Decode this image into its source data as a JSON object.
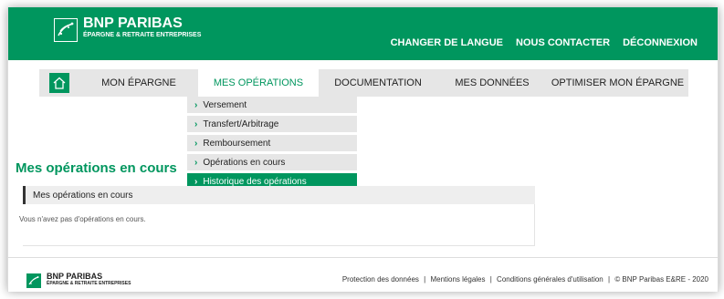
{
  "brand": {
    "name": "BNP PARIBAS",
    "sub": "ÉPARGNE & RETRAITE ENTREPRISES",
    "color": "#00965e"
  },
  "header_links": [
    "CHANGER DE LANGUE",
    "NOUS CONTACTER",
    "DÉCONNEXION"
  ],
  "nav": {
    "home_icon": "home-icon",
    "items": [
      {
        "label": "MON ÉPARGNE",
        "active": false
      },
      {
        "label": "MES OPÉRATIONS",
        "active": true
      },
      {
        "label": "DOCUMENTATION",
        "active": false
      },
      {
        "label": "MES DONNÉES",
        "active": false
      },
      {
        "label": "OPTIMISER MON ÉPARGNE",
        "active": false
      }
    ]
  },
  "dropdown": {
    "chevron": "›",
    "items": [
      "Versement",
      "Transfert/Arbitrage",
      "Remboursement",
      "Opérations en cours",
      "Historique des opérations"
    ]
  },
  "page": {
    "title": "Mes opérations en cours",
    "panel_title": "Mes opérations en cours",
    "empty_text": "Vous n'avez pas d'opérations en cours."
  },
  "footer": {
    "brand": "BNP PARIBAS",
    "brand_sub": "ÉPARGNE & RETRAITE ENTREPRISES",
    "links": [
      "Protection des données",
      "Mentions légales",
      "Conditions générales d'utilisation"
    ],
    "copyright": "© BNP Paribas E&RE - 2020",
    "separator": "|"
  }
}
